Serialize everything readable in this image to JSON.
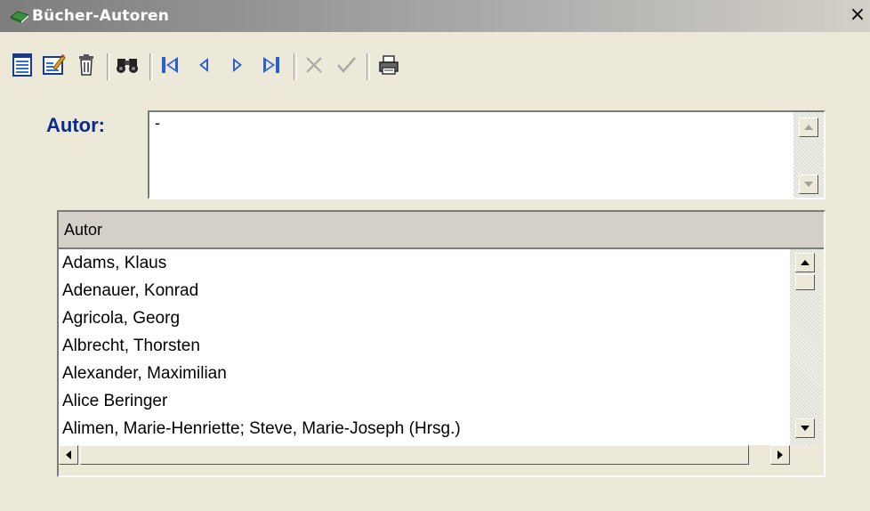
{
  "window": {
    "title": "Bücher-Autoren",
    "close_symbol": "×"
  },
  "toolbar": {
    "buttons": [
      {
        "name": "list-view-icon"
      },
      {
        "name": "edit-icon"
      },
      {
        "name": "trash-icon"
      },
      {
        "name": "binoculars-icon"
      },
      {
        "name": "first-record-icon"
      },
      {
        "name": "previous-record-icon"
      },
      {
        "name": "next-record-icon"
      },
      {
        "name": "last-record-icon"
      },
      {
        "name": "cancel-icon"
      },
      {
        "name": "confirm-icon"
      },
      {
        "name": "print-icon"
      }
    ]
  },
  "form": {
    "autor_label": "Autor:",
    "autor_value": "-"
  },
  "grid": {
    "column_header": "Autor",
    "rows": [
      "Adams, Klaus",
      "Adenauer, Konrad",
      "Agricola, Georg",
      "Albrecht, Thorsten",
      "Alexander, Maximilian",
      "Alice Beringer",
      "Alimen, Marie-Henriette; Steve, Marie-Joseph (Hrsg.)"
    ]
  },
  "colors": {
    "label_blue": "#0c2a88",
    "window_bg": "#ece9d8"
  }
}
